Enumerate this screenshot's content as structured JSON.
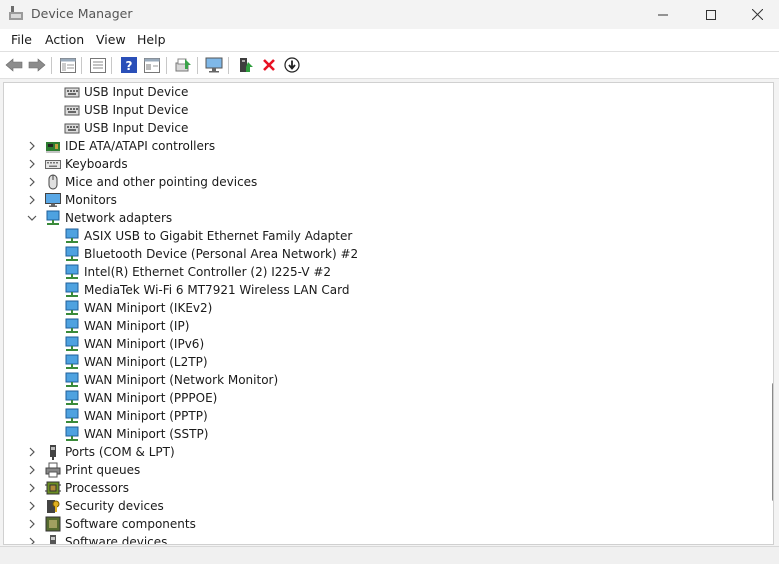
{
  "window": {
    "title": "Device Manager"
  },
  "menu": {
    "file": "File",
    "action": "Action",
    "view": "View",
    "help": "Help"
  },
  "toolbar": {
    "buttons": [
      "back-icon",
      "forward-icon",
      "tree-view-icon",
      "properties-icon",
      "help-icon",
      "device-view-icon",
      "scan-icon",
      "monitor-icon",
      "update-driver-icon",
      "uninstall-icon",
      "disable-icon"
    ]
  },
  "tree": {
    "usb_children": [
      "USB Input Device",
      "USB Input Device",
      "USB Input Device"
    ],
    "ide": "IDE ATA/ATAPI controllers",
    "keyboards": "Keyboards",
    "mice": "Mice and other pointing devices",
    "monitors": "Monitors",
    "network": "Network adapters",
    "network_children": [
      "ASIX USB to Gigabit Ethernet Family Adapter",
      "Bluetooth Device (Personal Area Network) #2",
      "Intel(R) Ethernet Controller (2) I225-V #2",
      "MediaTek Wi-Fi 6 MT7921 Wireless LAN Card",
      "WAN Miniport (IKEv2)",
      "WAN Miniport (IP)",
      "WAN Miniport (IPv6)",
      "WAN Miniport (L2TP)",
      "WAN Miniport (Network Monitor)",
      "WAN Miniport (PPPOE)",
      "WAN Miniport (PPTP)",
      "WAN Miniport (SSTP)"
    ],
    "ports": "Ports (COM & LPT)",
    "print_queues": "Print queues",
    "processors": "Processors",
    "security": "Security devices",
    "software_components": "Software components",
    "software_devices": "Software devices"
  },
  "colors": {
    "accent": "#0078d4",
    "network_icon": "#2b8fd6",
    "uninstall_red": "#e81123"
  }
}
